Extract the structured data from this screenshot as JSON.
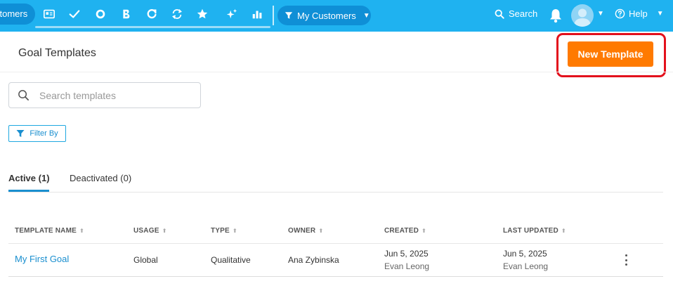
{
  "nav": {
    "customers_label": "stomers",
    "my_customers_label": "My Customers",
    "search_label": "Search",
    "help_label": "Help"
  },
  "header": {
    "title": "Goal Templates",
    "new_template_label": "New Template"
  },
  "search": {
    "placeholder": "Search templates",
    "value": ""
  },
  "filter": {
    "label": "Filter By"
  },
  "tabs": [
    {
      "label": "Active (1)",
      "active": true
    },
    {
      "label": "Deactivated (0)",
      "active": false
    }
  ],
  "table": {
    "columns": [
      "TEMPLATE NAME",
      "USAGE",
      "TYPE",
      "OWNER",
      "CREATED",
      "LAST UPDATED"
    ],
    "rows": [
      {
        "name": "My First Goal",
        "usage": "Global",
        "type": "Qualitative",
        "owner": "Ana Zybinska",
        "created_date": "Jun 5, 2025",
        "created_by": "Evan Leong",
        "updated_date": "Jun 5, 2025",
        "updated_by": "Evan Leong"
      }
    ]
  },
  "icons": {
    "nav": [
      "id-card-icon",
      "check-icon",
      "circle-icon",
      "bolt-b-icon",
      "refresh-circle-icon",
      "sync-icon",
      "star-icon",
      "sparkle-icon",
      "bar-chart-icon"
    ]
  },
  "colors": {
    "topbar": "#1fb2f0",
    "pill": "#0f8fd6",
    "primary_button": "#ff7a00",
    "highlight": "#e3101c",
    "link": "#1a8fcf"
  }
}
